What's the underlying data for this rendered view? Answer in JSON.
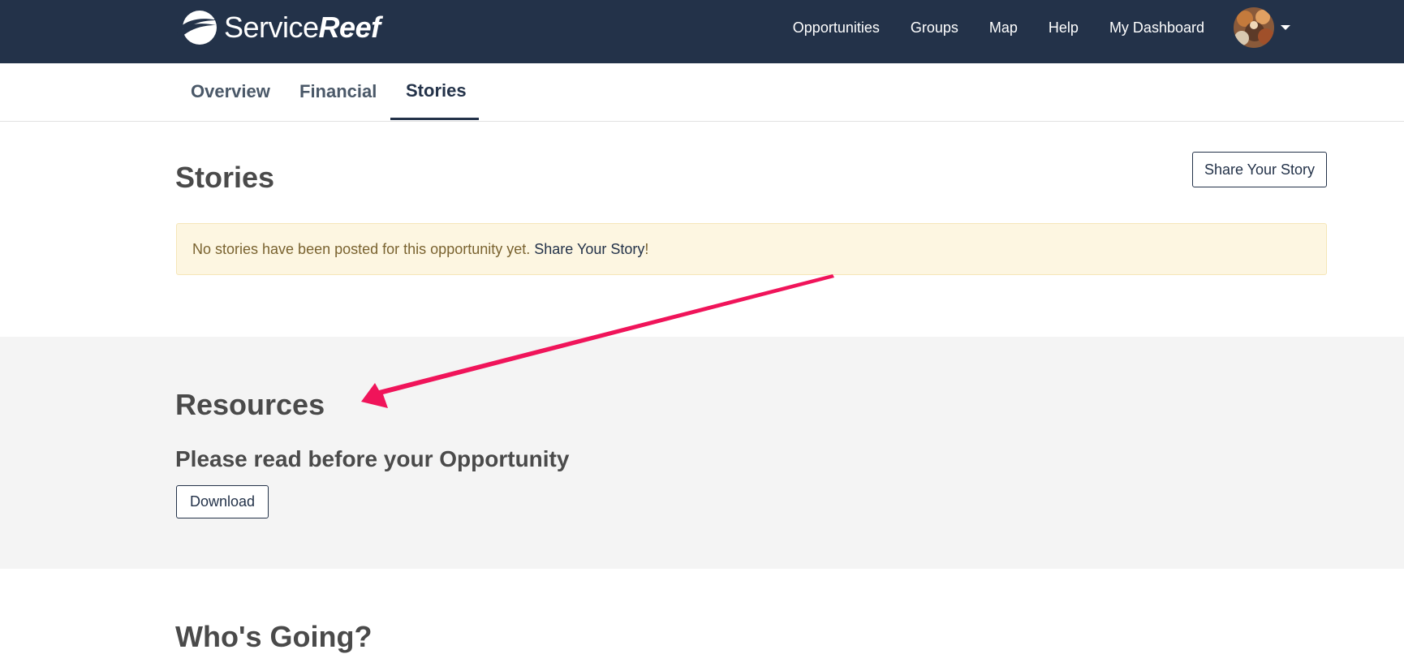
{
  "header": {
    "logo": {
      "text_light": "Service",
      "text_bold": "Reef"
    },
    "nav": [
      {
        "label": "Opportunities"
      },
      {
        "label": "Groups"
      },
      {
        "label": "Map"
      },
      {
        "label": "Help"
      },
      {
        "label": "My Dashboard"
      }
    ],
    "avatar_icon": "user-avatar",
    "caret_icon": "caret-down-icon",
    "background_color": "#233249"
  },
  "tabs": [
    {
      "label": "Overview",
      "active": false
    },
    {
      "label": "Financial",
      "active": false
    },
    {
      "label": "Stories",
      "active": true
    }
  ],
  "stories": {
    "title": "Stories",
    "share_button": "Share Your Story",
    "alert": {
      "text": "No stories have been posted for this opportunity yet. ",
      "link": "Share Your Story",
      "suffix": "!"
    }
  },
  "resources": {
    "title": "Resources",
    "subtitle": "Please read before your Opportunity",
    "download_button": "Download"
  },
  "whos_going": {
    "title": "Who's Going?"
  },
  "annotation": {
    "arrow_color": "#f0145a"
  }
}
